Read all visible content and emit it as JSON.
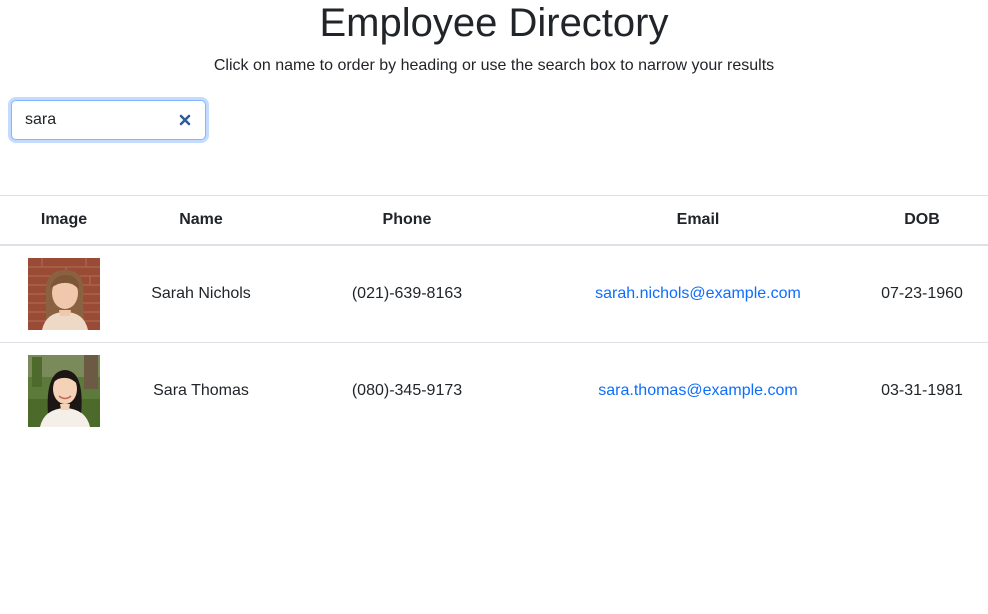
{
  "header": {
    "title": "Employee Directory",
    "subtitle": "Click on name to order by heading or use the search box to narrow your results"
  },
  "search": {
    "value": "sara",
    "clear_icon": "close-icon"
  },
  "table": {
    "columns": [
      "Image",
      "Name",
      "Phone",
      "Email",
      "DOB"
    ],
    "rows": [
      {
        "avatar_icon": "avatar",
        "name": "Sarah Nichols",
        "phone": "(021)-639-8163",
        "email": "sarah.nichols@example.com",
        "dob": "07-23-1960"
      },
      {
        "avatar_icon": "avatar",
        "name": "Sara Thomas",
        "phone": "(080)-345-9173",
        "email": "sara.thomas@example.com",
        "dob": "03-31-1981"
      }
    ]
  },
  "colors": {
    "link": "#0d6efd",
    "focus_border": "#86b7fe",
    "divider": "#dee2e6",
    "clear_icon": "#2f5f98"
  }
}
